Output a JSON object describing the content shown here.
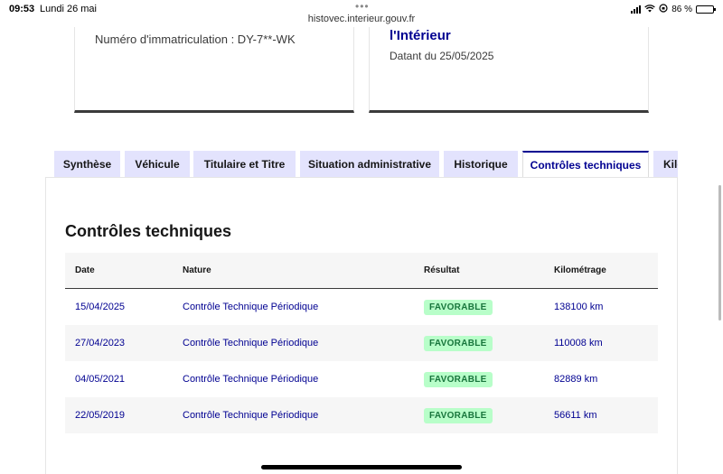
{
  "status_bar": {
    "time": "09:53",
    "date": "Lundi 26 mai",
    "url": "histovec.interieur.gouv.fr",
    "battery_percent": "86 %",
    "battery_level": 0.86
  },
  "cards": {
    "left": {
      "immatriculation": "Numéro d'immatriculation : DY-7**-WK"
    },
    "right": {
      "title": "l'Intérieur",
      "date": "Datant du 25/05/2025"
    }
  },
  "tabs": [
    {
      "label": "Synthèse",
      "active": false
    },
    {
      "label": "Véhicule",
      "active": false
    },
    {
      "label": "Titulaire et Titre",
      "active": false
    },
    {
      "label": "Situation administrative",
      "active": false
    },
    {
      "label": "Historique",
      "active": false
    },
    {
      "label": "Contrôles techniques",
      "active": true
    },
    {
      "label": "Kilométrage",
      "active": false
    }
  ],
  "section": {
    "title": "Contrôles techniques"
  },
  "table": {
    "headers": {
      "date": "Date",
      "nature": "Nature",
      "result": "Résultat",
      "km": "Kilométrage"
    },
    "rows": [
      {
        "date": "15/04/2025",
        "nature": "Contrôle Technique Périodique",
        "result": "FAVORABLE",
        "km": "138100 km"
      },
      {
        "date": "27/04/2023",
        "nature": "Contrôle Technique Périodique",
        "result": "FAVORABLE",
        "km": "110008 km"
      },
      {
        "date": "04/05/2021",
        "nature": "Contrôle Technique Périodique",
        "result": "FAVORABLE",
        "km": "82889 km"
      },
      {
        "date": "22/05/2019",
        "nature": "Contrôle Technique Périodique",
        "result": "FAVORABLE",
        "km": "56611 km"
      }
    ]
  },
  "colors": {
    "primary": "#000091",
    "tab_bg": "#e3e3fd",
    "badge_bg": "#b8fec9",
    "badge_text": "#18753c"
  }
}
